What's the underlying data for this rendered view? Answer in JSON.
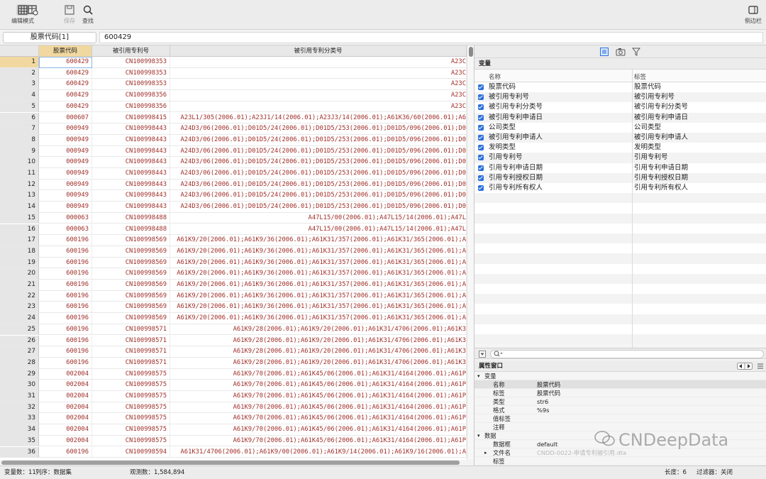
{
  "toolbar": {
    "edit_mode_label": "编辑模式",
    "save_label": "保存",
    "find_label": "查找",
    "sidebar_label": "侧边栏"
  },
  "cmdbar": {
    "var_ref": "股票代码[1]",
    "value": "600429"
  },
  "grid": {
    "columns": [
      "股票代码",
      "被引用专利号",
      "被引用专利分类号"
    ],
    "rows": [
      {
        "n": "1",
        "code": "600429",
        "pat": "CN100998353",
        "cls": "A23C"
      },
      {
        "n": "2",
        "code": "600429",
        "pat": "CN100998353",
        "cls": "A23C"
      },
      {
        "n": "3",
        "code": "600429",
        "pat": "CN100998353",
        "cls": "A23C"
      },
      {
        "n": "4",
        "code": "600429",
        "pat": "CN100998356",
        "cls": "A23C"
      },
      {
        "n": "5",
        "code": "600429",
        "pat": "CN100998356",
        "cls": "A23C"
      },
      {
        "n": "6",
        "code": "000607",
        "pat": "CN100998415",
        "cls": "A23L1/305(2006.01);A23J1/14(2006.01);A23J3/14(2006.01);A61K36/60(2006.01);A6"
      },
      {
        "n": "7",
        "code": "000949",
        "pat": "CN100998443",
        "cls": "A24D3/06(2006.01);D01D5/24(2006.01);D01D5/253(2006.01);D01D5/096(2006.01);D0"
      },
      {
        "n": "8",
        "code": "000949",
        "pat": "CN100998443",
        "cls": "A24D3/06(2006.01);D01D5/24(2006.01);D01D5/253(2006.01);D01D5/096(2006.01);D0"
      },
      {
        "n": "9",
        "code": "000949",
        "pat": "CN100998443",
        "cls": "A24D3/06(2006.01);D01D5/24(2006.01);D01D5/253(2006.01);D01D5/096(2006.01);D0"
      },
      {
        "n": "10",
        "code": "000949",
        "pat": "CN100998443",
        "cls": "A24D3/06(2006.01);D01D5/24(2006.01);D01D5/253(2006.01);D01D5/096(2006.01);D0"
      },
      {
        "n": "11",
        "code": "000949",
        "pat": "CN100998443",
        "cls": "A24D3/06(2006.01);D01D5/24(2006.01);D01D5/253(2006.01);D01D5/096(2006.01);D0"
      },
      {
        "n": "12",
        "code": "000949",
        "pat": "CN100998443",
        "cls": "A24D3/06(2006.01);D01D5/24(2006.01);D01D5/253(2006.01);D01D5/096(2006.01);D0"
      },
      {
        "n": "13",
        "code": "000949",
        "pat": "CN100998443",
        "cls": "A24D3/06(2006.01);D01D5/24(2006.01);D01D5/253(2006.01);D01D5/096(2006.01);D0"
      },
      {
        "n": "14",
        "code": "000949",
        "pat": "CN100998443",
        "cls": "A24D3/06(2006.01);D01D5/24(2006.01);D01D5/253(2006.01);D01D5/096(2006.01);D0"
      },
      {
        "n": "15",
        "code": "000063",
        "pat": "CN100998488",
        "cls": "A47L15/00(2006.01);A47L15/14(2006.01);A47L"
      },
      {
        "n": "16",
        "code": "000063",
        "pat": "CN100998488",
        "cls": "A47L15/00(2006.01);A47L15/14(2006.01);A47L"
      },
      {
        "n": "17",
        "code": "600196",
        "pat": "CN100998569",
        "cls": "A61K9/20(2006.01);A61K9/36(2006.01);A61K31/357(2006.01);A61K31/365(2006.01);A"
      },
      {
        "n": "18",
        "code": "600196",
        "pat": "CN100998569",
        "cls": "A61K9/20(2006.01);A61K9/36(2006.01);A61K31/357(2006.01);A61K31/365(2006.01);A"
      },
      {
        "n": "19",
        "code": "600196",
        "pat": "CN100998569",
        "cls": "A61K9/20(2006.01);A61K9/36(2006.01);A61K31/357(2006.01);A61K31/365(2006.01);A"
      },
      {
        "n": "20",
        "code": "600196",
        "pat": "CN100998569",
        "cls": "A61K9/20(2006.01);A61K9/36(2006.01);A61K31/357(2006.01);A61K31/365(2006.01);A"
      },
      {
        "n": "21",
        "code": "600196",
        "pat": "CN100998569",
        "cls": "A61K9/20(2006.01);A61K9/36(2006.01);A61K31/357(2006.01);A61K31/365(2006.01);A"
      },
      {
        "n": "22",
        "code": "600196",
        "pat": "CN100998569",
        "cls": "A61K9/20(2006.01);A61K9/36(2006.01);A61K31/357(2006.01);A61K31/365(2006.01);A"
      },
      {
        "n": "23",
        "code": "600196",
        "pat": "CN100998569",
        "cls": "A61K9/20(2006.01);A61K9/36(2006.01);A61K31/357(2006.01);A61K31/365(2006.01);A"
      },
      {
        "n": "24",
        "code": "600196",
        "pat": "CN100998569",
        "cls": "A61K9/20(2006.01);A61K9/36(2006.01);A61K31/357(2006.01);A61K31/365(2006.01);A"
      },
      {
        "n": "25",
        "code": "600196",
        "pat": "CN100998571",
        "cls": "A61K9/28(2006.01);A61K9/20(2006.01);A61K31/4706(2006.01);A61K3"
      },
      {
        "n": "26",
        "code": "600196",
        "pat": "CN100998571",
        "cls": "A61K9/28(2006.01);A61K9/20(2006.01);A61K31/4706(2006.01);A61K3"
      },
      {
        "n": "27",
        "code": "600196",
        "pat": "CN100998571",
        "cls": "A61K9/28(2006.01);A61K9/20(2006.01);A61K31/4706(2006.01);A61K3"
      },
      {
        "n": "28",
        "code": "600196",
        "pat": "CN100998571",
        "cls": "A61K9/28(2006.01);A61K9/20(2006.01);A61K31/4706(2006.01);A61K3"
      },
      {
        "n": "29",
        "code": "002004",
        "pat": "CN100998575",
        "cls": "A61K9/70(2006.01);A61K45/06(2006.01);A61K31/4164(2006.01);A61P"
      },
      {
        "n": "30",
        "code": "002004",
        "pat": "CN100998575",
        "cls": "A61K9/70(2006.01);A61K45/06(2006.01);A61K31/4164(2006.01);A61P"
      },
      {
        "n": "31",
        "code": "002004",
        "pat": "CN100998575",
        "cls": "A61K9/70(2006.01);A61K45/06(2006.01);A61K31/4164(2006.01);A61P"
      },
      {
        "n": "32",
        "code": "002004",
        "pat": "CN100998575",
        "cls": "A61K9/70(2006.01);A61K45/06(2006.01);A61K31/4164(2006.01);A61P"
      },
      {
        "n": "33",
        "code": "002004",
        "pat": "CN100998575",
        "cls": "A61K9/70(2006.01);A61K45/06(2006.01);A61K31/4164(2006.01);A61P"
      },
      {
        "n": "34",
        "code": "002004",
        "pat": "CN100998575",
        "cls": "A61K9/70(2006.01);A61K45/06(2006.01);A61K31/4164(2006.01);A61P"
      },
      {
        "n": "35",
        "code": "002004",
        "pat": "CN100998575",
        "cls": "A61K9/70(2006.01);A61K45/06(2006.01);A61K31/4164(2006.01);A61P"
      },
      {
        "n": "36",
        "code": "600196",
        "pat": "CN100998594",
        "cls": "A61K31/4706(2006.01);A61K9/00(2006.01);A61K9/14(2006.01);A61K9/16(2006.01);A"
      }
    ]
  },
  "variables_panel": {
    "title": "变量",
    "col_name": "名称",
    "col_label": "标签",
    "items": [
      {
        "name": "股票代码",
        "label": "股票代码"
      },
      {
        "name": "被引用专利号",
        "label": "被引用专利号"
      },
      {
        "name": "被引用专利分类号",
        "label": "被引用专利分类号"
      },
      {
        "name": "被引用专利申请日",
        "label": "被引用专利申请日"
      },
      {
        "name": "公司类型",
        "label": "公司类型"
      },
      {
        "name": "被引用专利申请人",
        "label": "被引用专利申请人"
      },
      {
        "name": "发明类型",
        "label": "发明类型"
      },
      {
        "name": "引用专利号",
        "label": "引用专利号"
      },
      {
        "name": "引用专利申请日期",
        "label": "引用专利申请日期"
      },
      {
        "name": "引用专利授权日期",
        "label": "引用专利授权日期"
      },
      {
        "name": "引用专利所有权人",
        "label": "引用专利所有权人"
      }
    ]
  },
  "properties_panel": {
    "title": "属性窗口",
    "var_section": "变量",
    "var_props": [
      {
        "k": "名称",
        "v": "股票代码"
      },
      {
        "k": "标签",
        "v": "股票代码"
      },
      {
        "k": "类型",
        "v": "str6"
      },
      {
        "k": "格式",
        "v": "%9s"
      },
      {
        "k": "值标签",
        "v": ""
      },
      {
        "k": "注释",
        "v": ""
      }
    ],
    "data_section": "数据",
    "data_props": [
      {
        "k": "数据框",
        "v": "default"
      },
      {
        "k": "文件名",
        "v": "CNDD-0022-申请专利被引用.dta"
      },
      {
        "k": "标签",
        "v": ""
      }
    ]
  },
  "status": {
    "vars": "变量数：11",
    "order": "列序：数据集",
    "obs": "观测数：1,584,894",
    "length": "长度：6",
    "filter": "过滤器：关闭"
  },
  "watermark": "CNDeepData",
  "colors": {
    "accent": "#2a6fdb",
    "data_text": "#a0302a",
    "selected_header": "#f1d8a0"
  }
}
